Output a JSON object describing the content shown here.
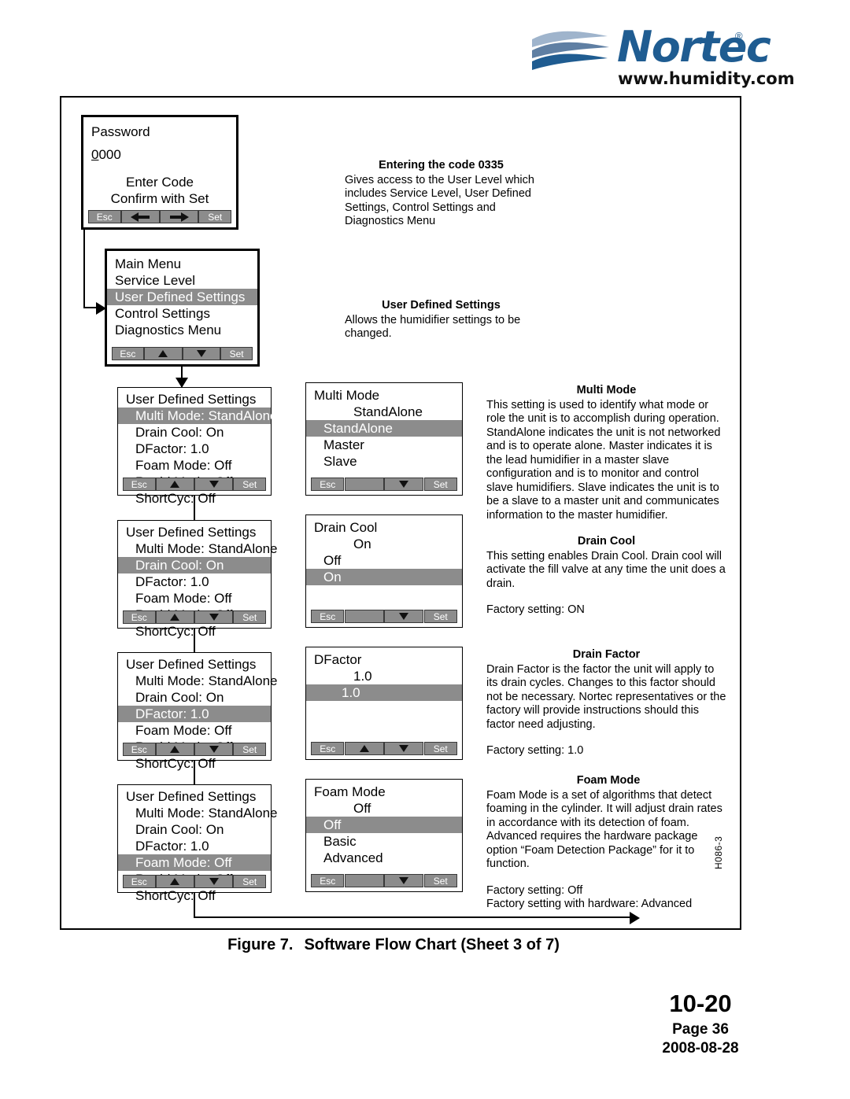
{
  "brand": {
    "name": "Nortec",
    "registered": "®",
    "url": "www.humidity.com"
  },
  "figure": {
    "caption_number": "Figure 7.",
    "caption_title": "Software Flow Chart (Sheet 3 of 7)",
    "doc_code": "H086-3"
  },
  "footer": {
    "section": "10-20",
    "page": "Page 36",
    "date": "2008-08-28"
  },
  "keys": {
    "esc": "Esc",
    "set": "Set",
    "up": "up-arrow",
    "down": "down-arrow",
    "left": "left-arrow",
    "right": "right-arrow",
    "blank": ""
  },
  "screens": {
    "password": {
      "title": "Password",
      "value_first": "0",
      "value_rest": "000",
      "line1": "Enter Code",
      "line2": "Confirm with Set"
    },
    "main_menu": {
      "title": "Main Menu",
      "items": [
        {
          "label": "Service Level",
          "highlighted": false
        },
        {
          "label": "User Defined Settings",
          "highlighted": true
        },
        {
          "label": "Control Settings",
          "highlighted": false
        },
        {
          "label": "Diagnostics Menu",
          "highlighted": false
        }
      ]
    },
    "uds_multi_mode": {
      "title": "User Defined Settings",
      "items": [
        {
          "label": "Multi Mode: StandAlone",
          "highlighted": true
        },
        {
          "label": "Drain Cool: On",
          "highlighted": false
        },
        {
          "label": "DFactor: 1.0",
          "highlighted": false
        },
        {
          "label": "Foam Mode: Off",
          "highlighted": false
        },
        {
          "label": "Rapid Modu: Off",
          "highlighted": false
        },
        {
          "label": "ShortCyc: Off",
          "highlighted": false
        }
      ]
    },
    "uds_drain_cool": {
      "title": "User Defined Settings",
      "items": [
        {
          "label": "Multi Mode: StandAlone",
          "highlighted": false
        },
        {
          "label": "Drain Cool: On",
          "highlighted": true
        },
        {
          "label": "DFactor: 1.0",
          "highlighted": false
        },
        {
          "label": "Foam Mode: Off",
          "highlighted": false
        },
        {
          "label": "Rapid Modu: Off",
          "highlighted": false
        },
        {
          "label": "ShortCyc: Off",
          "highlighted": false
        }
      ]
    },
    "uds_dfactor": {
      "title": "User Defined Settings",
      "items": [
        {
          "label": "Multi Mode: StandAlone",
          "highlighted": false
        },
        {
          "label": "Drain Cool: On",
          "highlighted": false
        },
        {
          "label": "DFactor: 1.0",
          "highlighted": true
        },
        {
          "label": "Foam Mode: Off",
          "highlighted": false
        },
        {
          "label": "Rapid Modu: Off",
          "highlighted": false
        },
        {
          "label": "ShortCyc: Off",
          "highlighted": false
        }
      ]
    },
    "uds_foam_mode": {
      "title": "User Defined Settings",
      "items": [
        {
          "label": "Multi Mode: StandAlone",
          "highlighted": false
        },
        {
          "label": "Drain Cool: On",
          "highlighted": false
        },
        {
          "label": "DFactor: 1.0",
          "highlighted": false
        },
        {
          "label": "Foam Mode: Off",
          "highlighted": true
        },
        {
          "label": "Rapid Modu: Off",
          "highlighted": false
        },
        {
          "label": "ShortCyc: Off",
          "highlighted": false
        }
      ]
    },
    "multi_mode": {
      "title": "Multi Mode",
      "current": "StandAlone",
      "options": [
        {
          "label": "StandAlone",
          "highlighted": true
        },
        {
          "label": "Master",
          "highlighted": false
        },
        {
          "label": "Slave",
          "highlighted": false
        }
      ]
    },
    "drain_cool": {
      "title": "Drain Cool",
      "current": "On",
      "options": [
        {
          "label": "Off",
          "highlighted": false
        },
        {
          "label": "On",
          "highlighted": true
        }
      ]
    },
    "dfactor": {
      "title": "DFactor",
      "current": "1.0",
      "options": [
        {
          "label": "1.0",
          "highlighted": true
        }
      ]
    },
    "foam_mode": {
      "title": "Foam Mode",
      "current": "Off",
      "options": [
        {
          "label": "Off",
          "highlighted": true
        },
        {
          "label": "Basic",
          "highlighted": false
        },
        {
          "label": "Advanced",
          "highlighted": false
        }
      ]
    }
  },
  "notes": {
    "entering_code": {
      "heading": "Entering the code 0335",
      "body": "Gives access to the User Level which includes Service Level, User Defined Settings, Control Settings and Diagnostics Menu"
    },
    "user_defined_settings": {
      "heading": "User Defined Settings",
      "body": "Allows the humidifier settings to be changed."
    },
    "multi_mode": {
      "heading": "Multi Mode",
      "body": "This setting is used to identify what mode or role the unit is to accomplish during operation. StandAlone indicates the unit is not networked and is to operate alone. Master indicates it is the lead humidifier in a master slave configuration and is to monitor and control slave humidifiers. Slave indicates the unit is to be a slave to a master unit and communicates information to the master humidifier."
    },
    "drain_cool": {
      "heading": "Drain Cool",
      "body": "This setting enables Drain Cool.  Drain cool will activate the fill valve at any time the unit does a drain.",
      "factory": "Factory setting: ON"
    },
    "drain_factor": {
      "heading": "Drain Factor",
      "body": "Drain Factor is the factor the unit will apply to its drain cycles. Changes to this factor should not be necessary.  Nortec representatives or the factory will provide instructions should this factor need adjusting.",
      "factory": "Factory setting: 1.0"
    },
    "foam_mode": {
      "heading": "Foam Mode",
      "body": "Foam Mode is a set of algorithms that detect foaming in the cylinder.  It will adjust drain rates in accordance with its detection of foam. Advanced requires the hardware package option “Foam Detection Package” for it to function.",
      "factory": "Factory setting: Off",
      "factory2": "Factory setting with hardware: Advanced"
    }
  }
}
